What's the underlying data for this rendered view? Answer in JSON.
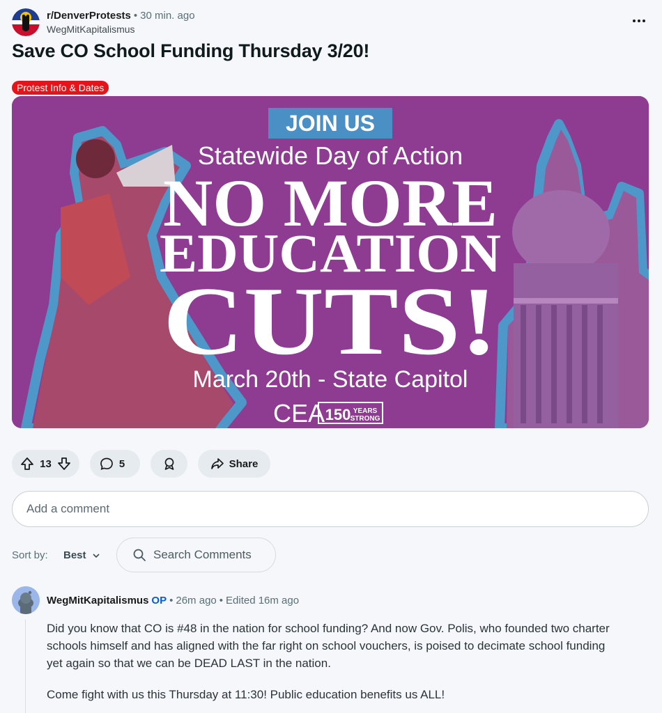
{
  "post": {
    "subreddit": "r/DenverProtests",
    "time": "30 min. ago",
    "author": "WegMitKapitalismus",
    "title": "Save CO School Funding Thursday 3/20!",
    "flair": "Protest Info & Dates",
    "flair_color": "#e5141b",
    "image": {
      "banner_tag": "JOIN US",
      "subtitle": "Statewide Day of Action",
      "headline_1": "NO MORE",
      "headline_2": "EDUCATION",
      "headline_3": "CUTS!",
      "footer": "March 20th - State Capitol",
      "logo_text": "CEA",
      "badge_number": "150",
      "badge_years": "YEARS",
      "badge_strong": "STRONG",
      "background_color": "#8e3b92",
      "accent_color": "#4e97c9"
    }
  },
  "actions": {
    "upvote_icon": "arrow-up-icon",
    "downvote_icon": "arrow-down-icon",
    "vote_count": "13",
    "comment_icon": "speech-bubble-icon",
    "comment_count": "5",
    "award_icon": "award-icon",
    "share_icon": "share-arrow-icon",
    "share_label": "Share"
  },
  "comment_box": {
    "placeholder": "Add a comment"
  },
  "sort": {
    "label": "Sort by:",
    "value": "Best",
    "search_placeholder": "Search Comments"
  },
  "comments": [
    {
      "author": "WegMitKapitalismus",
      "op_badge": "OP",
      "time": "26m ago",
      "edited": "Edited 16m ago",
      "paragraphs": [
        "Did you know that CO is #48 in the nation for school funding? And now Gov. Polis, who founded two charter schools himself and has aligned with the far right on school vouchers, is poised to decimate school funding yet again so that we can be DEAD LAST in the nation.",
        "Come fight with us this Thursday at 11:30! Public education benefits us ALL!"
      ]
    }
  ]
}
